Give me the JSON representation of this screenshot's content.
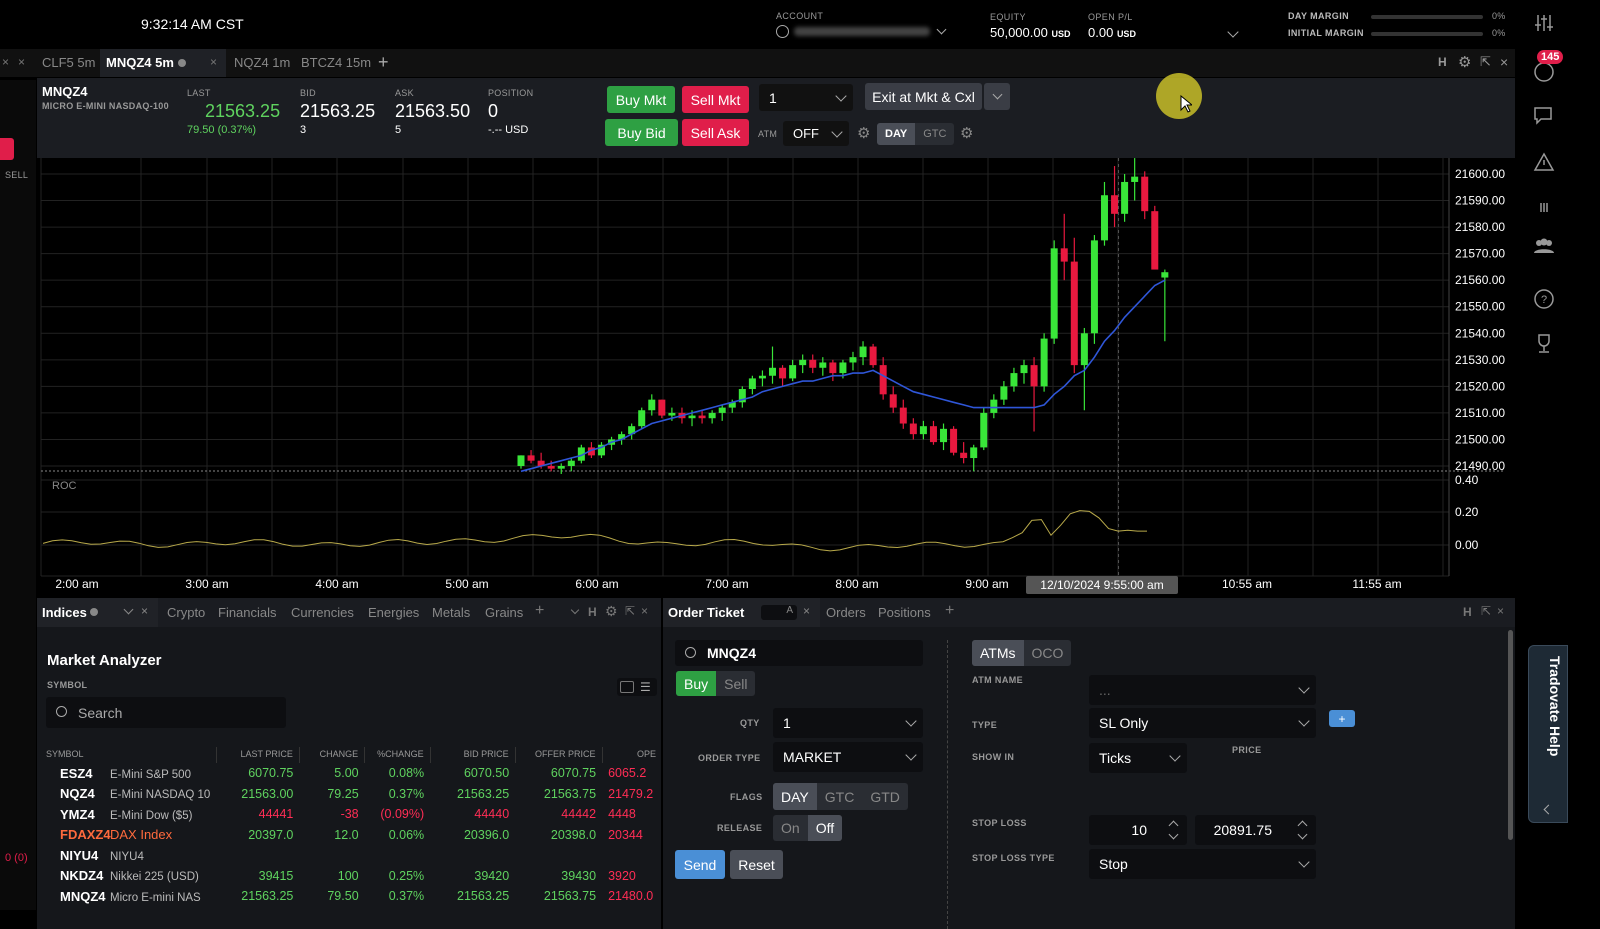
{
  "header": {
    "clock": "9:32:14 AM CST",
    "account_label": "ACCOUNT",
    "equity_label": "EQUITY",
    "equity_value": "50,000.00",
    "equity_unit": "USD",
    "open_pl_label": "OPEN P/L",
    "open_pl_value": "0.00",
    "open_pl_unit": "USD",
    "day_margin_label": "DAY MARGIN",
    "day_margin_pct": "0%",
    "initial_margin_label": "INITIAL MARGIN",
    "initial_margin_pct": "0%"
  },
  "chart_tabs": [
    {
      "label": "CLF5 5m"
    },
    {
      "label": "MNQZ4 5m"
    },
    {
      "label": "NQZ4 1m"
    },
    {
      "label": "BTCZ4 15m"
    }
  ],
  "quote": {
    "symbol": "MNQZ4",
    "description": "MICRO E-MINI NASDAQ-100",
    "last_label": "LAST",
    "last": "21563.25",
    "change": "79.50 (0.37%)",
    "bid_label": "BID",
    "bid": "21563.25",
    "bid_size": "3",
    "ask_label": "ASK",
    "ask": "21563.50",
    "ask_size": "5",
    "position_label": "POSITION",
    "position": "0",
    "position_usd": "-.-- USD"
  },
  "trade_buttons": {
    "buy_mkt": "Buy Mkt",
    "sell_mkt": "Sell Mkt",
    "buy_bid": "Buy Bid",
    "sell_ask": "Sell Ask",
    "qty": "1",
    "exit": "Exit at Mkt & Cxl",
    "atm_label": "ATM",
    "atm_value": "OFF",
    "day": "DAY",
    "gtc": "GTC"
  },
  "left_edge": {
    "sell_label": "SELL",
    "pos_label": "0 (0)"
  },
  "notifications": {
    "badge": "145"
  },
  "chart_data": {
    "type": "candlestick",
    "price_ticks": [
      "21600.00",
      "21590.00",
      "21580.00",
      "21570.00",
      "21560.00",
      "21550.00",
      "21540.00",
      "21530.00",
      "21520.00",
      "21510.00",
      "21500.00",
      "21490.00"
    ],
    "time_ticks": [
      "2:00 am",
      "3:00 am",
      "4:00 am",
      "5:00 am",
      "6:00 am",
      "7:00 am",
      "8:00 am",
      "9:00 am",
      "10:55 am",
      "11:55 am"
    ],
    "crosshair_time": "12/10/2024 9:55:00 am",
    "indicator_label": "ROC",
    "indicator_ticks": [
      "0.40",
      "0.20",
      "0.00"
    ],
    "candles": [
      [
        21490,
        21494,
        21489,
        21494
      ],
      [
        21494,
        21496,
        21491,
        21492
      ],
      [
        21492,
        21495,
        21489,
        21490
      ],
      [
        21490,
        21492,
        21488,
        21489
      ],
      [
        21489,
        21491,
        21487,
        21490
      ],
      [
        21490,
        21493,
        21488,
        21492
      ],
      [
        21492,
        21498,
        21491,
        21497
      ],
      [
        21497,
        21499,
        21493,
        21494
      ],
      [
        21494,
        21499,
        21493,
        21498
      ],
      [
        21498,
        21501,
        21496,
        21500
      ],
      [
        21500,
        21503,
        21498,
        21502
      ],
      [
        21502,
        21506,
        21500,
        21505
      ],
      [
        21505,
        21512,
        21504,
        21511
      ],
      [
        21511,
        21517,
        21509,
        21515
      ],
      [
        21515,
        21515,
        21508,
        21509
      ],
      [
        21509,
        21512,
        21507,
        21510
      ],
      [
        21510,
        21512,
        21506,
        21508
      ],
      [
        21508,
        21511,
        21505,
        21509
      ],
      [
        21509,
        21511,
        21506,
        21508
      ],
      [
        21508,
        21511,
        21506,
        21510
      ],
      [
        21510,
        21513,
        21507,
        21512
      ],
      [
        21512,
        21515,
        21510,
        21514
      ],
      [
        21514,
        21520,
        21512,
        21519
      ],
      [
        21519,
        21524,
        21517,
        21523
      ],
      [
        21523,
        21526,
        21520,
        21524
      ],
      [
        21524,
        21535,
        21521,
        21527
      ],
      [
        21527,
        21528,
        21520,
        21523
      ],
      [
        21523,
        21530,
        21522,
        21528
      ],
      [
        21528,
        21532,
        21525,
        21530
      ],
      [
        21530,
        21532,
        21525,
        21527
      ],
      [
        21527,
        21531,
        21524,
        21529
      ],
      [
        21529,
        21530,
        21522,
        21525
      ],
      [
        21525,
        21530,
        21523,
        21529
      ],
      [
        21529,
        21533,
        21526,
        21531
      ],
      [
        21531,
        21537,
        21528,
        21535
      ],
      [
        21535,
        21536,
        21527,
        21528
      ],
      [
        21528,
        21531,
        21515,
        21517
      ],
      [
        21517,
        21520,
        21510,
        21512
      ],
      [
        21512,
        21515,
        21504,
        21506
      ],
      [
        21506,
        21508,
        21500,
        21502
      ],
      [
        21502,
        21507,
        21500,
        21505
      ],
      [
        21505,
        21507,
        21498,
        21499
      ],
      [
        21499,
        21506,
        21496,
        21504
      ],
      [
        21504,
        21505,
        21494,
        21495
      ],
      [
        21495,
        21499,
        21491,
        21493
      ],
      [
        21493,
        21498,
        21488,
        21497
      ],
      [
        21497,
        21512,
        21496,
        21510
      ],
      [
        21510,
        21517,
        21508,
        21515
      ],
      [
        21515,
        21522,
        21513,
        21520
      ],
      [
        21520,
        21527,
        21518,
        21525
      ],
      [
        21525,
        21530,
        21521,
        21528
      ],
      [
        21528,
        21531,
        21503,
        21520
      ],
      [
        21520,
        21540,
        21518,
        21538
      ],
      [
        21538,
        21575,
        21536,
        21572
      ],
      [
        21572,
        21585,
        21560,
        21567
      ],
      [
        21567,
        21576,
        21525,
        21528
      ],
      [
        21528,
        21542,
        21511,
        21540
      ],
      [
        21540,
        21577,
        21536,
        21575
      ],
      [
        21575,
        21597,
        21573,
        21592
      ],
      [
        21592,
        21603,
        21580,
        21585
      ],
      [
        21585,
        21600,
        21582,
        21597
      ],
      [
        21597,
        21606,
        21590,
        21599
      ],
      [
        21599,
        21601,
        21583,
        21586
      ],
      [
        21586,
        21588,
        21570,
        21564
      ],
      [
        21561,
        21564,
        21537,
        21563
      ]
    ],
    "vwap": [
      21488,
      21489,
      21490,
      21491,
      21492,
      21493,
      21494,
      21496,
      21497,
      21499,
      21500,
      21502,
      21504,
      21506,
      21507,
      21508,
      21509,
      21510,
      21511,
      21512,
      21513,
      21514,
      21515,
      21516,
      21518,
      21519,
      21520,
      21521,
      21522,
      21522,
      21523,
      21524,
      21524,
      21525,
      21525,
      21526,
      21524,
      21522,
      21520,
      21518,
      21517,
      21516,
      21515,
      21514,
      21513,
      21512,
      21512,
      21512,
      21512,
      21512,
      21512,
      21512,
      21513,
      21517,
      21520,
      21524,
      21526,
      21531,
      21537,
      21541,
      21546,
      21550,
      21554,
      21558,
      21560
    ]
  },
  "bottom_tabs": {
    "left": [
      "Indices",
      "Crypto",
      "Financials",
      "Currencies",
      "Energies",
      "Metals",
      "Grains"
    ],
    "right": [
      "Order Ticket",
      "Orders",
      "Positions"
    ]
  },
  "market_analyzer": {
    "title": "Market Analyzer",
    "symbol_label": "SYMBOL",
    "search_placeholder": "Search",
    "columns": [
      "SYMBOL",
      "LAST PRICE",
      "CHANGE",
      "%CHANGE",
      "BID PRICE",
      "OFFER PRICE",
      "OPE"
    ],
    "rows": [
      {
        "sym": "ESZ4",
        "name": "E-Mini S&P 500",
        "last": "6070.75",
        "chg": "5.00",
        "pct": "0.08%",
        "bid": "6070.50",
        "offer": "6070.75",
        "open": "6065.2",
        "dir": "up"
      },
      {
        "sym": "NQZ4",
        "name": "E-Mini NASDAQ 10",
        "last": "21563.00",
        "chg": "79.25",
        "pct": "0.37%",
        "bid": "21563.25",
        "offer": "21563.75",
        "open": "21479.2",
        "dir": "up"
      },
      {
        "sym": "YMZ4",
        "name": "E-Mini Dow ($5)",
        "last": "44441",
        "chg": "-38",
        "pct": "(0.09%)",
        "bid": "44440",
        "offer": "44442",
        "open": "4448",
        "dir": "dn"
      },
      {
        "sym": "FDAXZ4",
        "name": "DAX Index",
        "last": "20397.0",
        "chg": "12.0",
        "pct": "0.06%",
        "bid": "20396.0",
        "offer": "20398.0",
        "open": "20344",
        "dir": "up"
      },
      {
        "sym": "NIYU4",
        "name": "NIYU4",
        "last": "",
        "chg": "",
        "pct": "",
        "bid": "",
        "offer": "",
        "open": "",
        "dir": "none"
      },
      {
        "sym": "NKDZ4",
        "name": "Nikkei 225 (USD)",
        "last": "39415",
        "chg": "100",
        "pct": "0.25%",
        "bid": "39420",
        "offer": "39430",
        "open": "3920",
        "dir": "up"
      },
      {
        "sym": "MNQZ4",
        "name": "Micro E-mini NAS",
        "last": "21563.25",
        "chg": "79.50",
        "pct": "0.37%",
        "bid": "21563.25",
        "offer": "21563.75",
        "open": "21480.0",
        "dir": "up"
      }
    ]
  },
  "order_ticket": {
    "symbol": "MNQZ4",
    "buy": "Buy",
    "sell": "Sell",
    "qty_label": "QTY",
    "qty": "1",
    "order_type_label": "ORDER TYPE",
    "order_type": "MARKET",
    "flags_label": "FLAGS",
    "flags": [
      "DAY",
      "GTC",
      "GTD"
    ],
    "release_label": "RELEASE",
    "release_on": "On",
    "release_off": "Off",
    "send": "Send",
    "reset": "Reset",
    "atms_tab": "ATMs",
    "oco_tab": "OCO",
    "atm_name_label": "ATM NAME",
    "atm_name_value": "...",
    "type_label": "TYPE",
    "type_value": "SL Only",
    "show_in_label": "SHOW IN",
    "show_in_value": "Ticks",
    "price_label": "PRICE",
    "stop_loss_label": "STOP LOSS",
    "stop_loss_ticks": "10",
    "stop_loss_price": "20891.75",
    "stop_loss_type_label": "STOP LOSS TYPE",
    "stop_loss_type": "Stop",
    "add_button": "+"
  },
  "help_tab": "Tradovate Help"
}
